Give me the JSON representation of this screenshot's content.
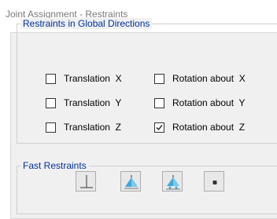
{
  "window": {
    "title": "Joint Assignment - Restraints"
  },
  "global_restraints": {
    "group_label": "Restraints in Global Directions",
    "translation_x": {
      "label": "Translation  X",
      "checked": false
    },
    "translation_y": {
      "label": "Translation  Y",
      "checked": false
    },
    "translation_z": {
      "label": "Translation  Z",
      "checked": false
    },
    "rotation_x": {
      "label": "Rotation about  X",
      "checked": false
    },
    "rotation_y": {
      "label": "Rotation about  Y",
      "checked": false
    },
    "rotation_z": {
      "label": "Rotation about  Z",
      "checked": true
    }
  },
  "fast_restraints": {
    "group_label": "Fast Restraints",
    "buttons": [
      {
        "icon": "fixed-support-icon"
      },
      {
        "icon": "pinned-support-icon"
      },
      {
        "icon": "roller-support-icon"
      },
      {
        "icon": "free-joint-icon"
      }
    ]
  },
  "colors": {
    "group_label": "#00329b",
    "panel_bg": "#f0f0f0",
    "support_blue": "#3fa8d8"
  }
}
